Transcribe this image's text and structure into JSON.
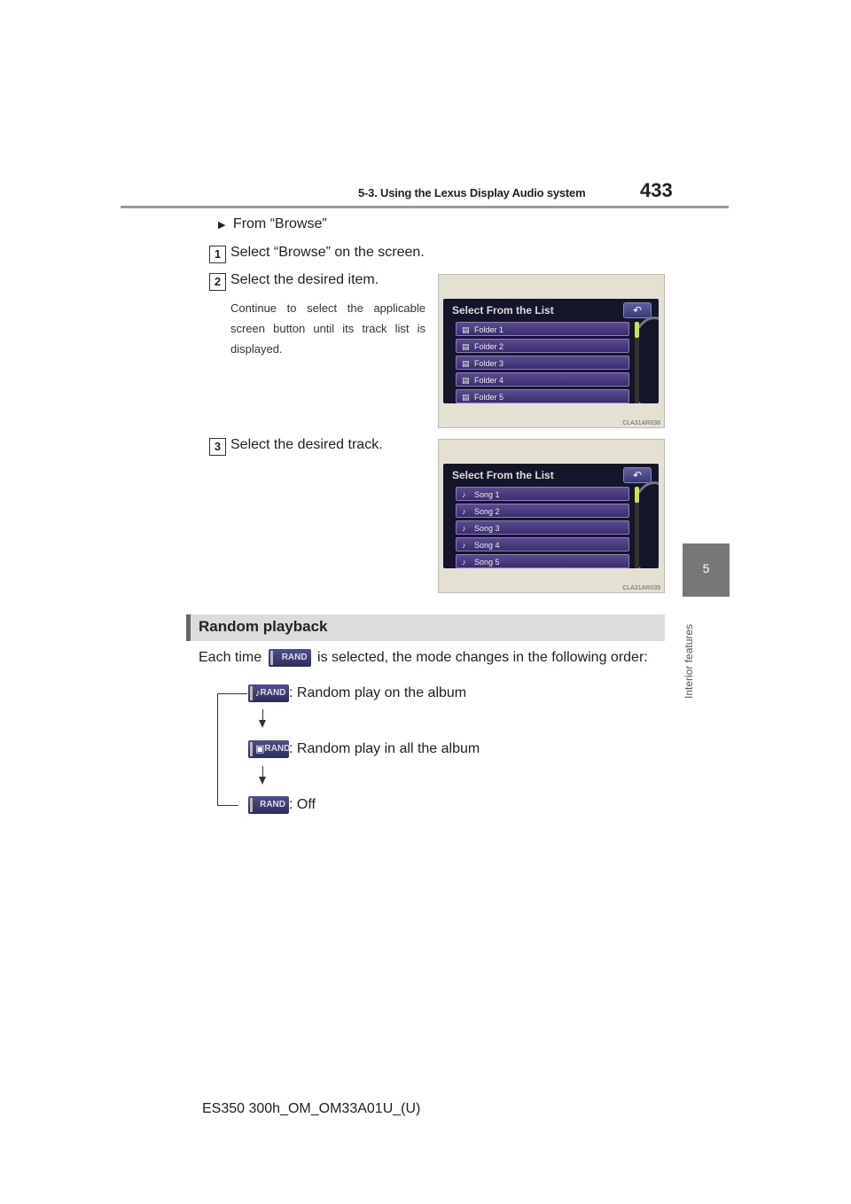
{
  "header": {
    "section": "5-3. Using the Lexus Display Audio system",
    "page_number": "433"
  },
  "side_tab": {
    "number": "5",
    "label": "Interior features"
  },
  "browse": {
    "heading": "From “Browse”",
    "steps": [
      {
        "num": "1",
        "text": "Select “Browse” on the screen."
      },
      {
        "num": "2",
        "text": "Select the desired item.",
        "note": "Continue to select the applicable screen button until its track list is displayed."
      },
      {
        "num": "3",
        "text": "Select the desired track."
      }
    ]
  },
  "screen1": {
    "title": "Select From the List",
    "items": [
      "Folder 1",
      "Folder 2",
      "Folder 3",
      "Folder 4",
      "Folder 5"
    ],
    "item_icon": "folder-icon",
    "code": "CLA31AR038"
  },
  "screen2": {
    "title": "Select From the List",
    "items": [
      "Song  1",
      "Song  2",
      "Song  3",
      "Song  4",
      "Song  5"
    ],
    "item_icon": "note-icon",
    "code": "CLA31AR039"
  },
  "random": {
    "heading": "Random playback",
    "intro_before": "Each time",
    "intro_after": "is selected, the mode changes in the following order:",
    "button_label": "RAND",
    "modes": [
      {
        "icon": "music-note-icon",
        "text": ": Random play on the album"
      },
      {
        "icon": "album-icon",
        "text": ": Random play in all the album"
      },
      {
        "icon": "",
        "text": ": Off"
      }
    ]
  },
  "footer": {
    "code": "ES350 300h_OM_OM33A01U_(U)"
  }
}
